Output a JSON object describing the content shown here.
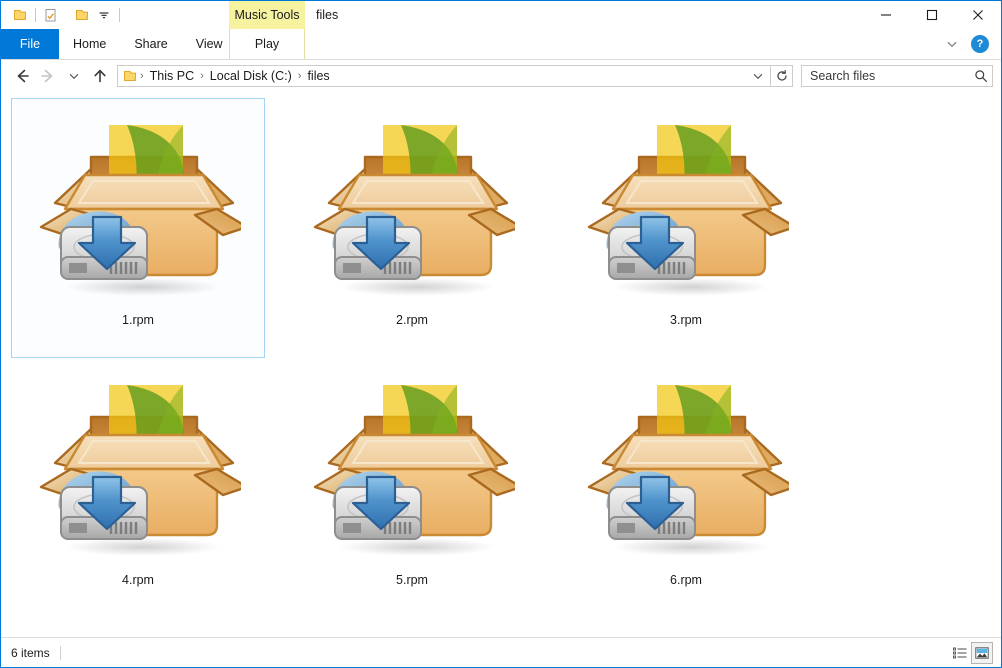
{
  "window": {
    "title": "files",
    "accent_color": "#0078d7",
    "contextual_tab_group": "Music Tools",
    "contextual_tab_color": "#f6f2a0"
  },
  "quick_access": {
    "items": [
      {
        "name": "folder-icon",
        "label": "Folder"
      },
      {
        "name": "properties-icon",
        "label": "Properties"
      },
      {
        "name": "new-folder-icon",
        "label": "New folder"
      },
      {
        "name": "customize-dropdown-icon",
        "label": "Customize Quick Access Toolbar"
      }
    ]
  },
  "window_controls": {
    "minimize": "Minimize",
    "maximize": "Maximize",
    "close": "Close",
    "ribbon_toggle": "Minimize the Ribbon",
    "help": "?"
  },
  "ribbon": {
    "tabs": [
      {
        "label": "File",
        "active_style": "file"
      },
      {
        "label": "Home",
        "active_style": "normal"
      },
      {
        "label": "Share",
        "active_style": "normal"
      },
      {
        "label": "View",
        "active_style": "normal"
      },
      {
        "label": "Play",
        "active_style": "contextual"
      }
    ]
  },
  "address_bar": {
    "back": "Back",
    "forward": "Forward",
    "recent": "Recent locations",
    "up": "Up",
    "breadcrumbs": [
      {
        "label": "This PC"
      },
      {
        "label": "Local Disk (C:)"
      },
      {
        "label": "files"
      }
    ],
    "separator": "›",
    "dropdown": "Previous locations",
    "refresh": "Refresh"
  },
  "search": {
    "placeholder": "Search files",
    "value": "",
    "icon": "search-icon"
  },
  "files": [
    {
      "name": "1.rpm",
      "type": "rpm-package",
      "selected": true
    },
    {
      "name": "2.rpm",
      "type": "rpm-package",
      "selected": false
    },
    {
      "name": "3.rpm",
      "type": "rpm-package",
      "selected": false
    },
    {
      "name": "4.rpm",
      "type": "rpm-package",
      "selected": false
    },
    {
      "name": "5.rpm",
      "type": "rpm-package",
      "selected": false
    },
    {
      "name": "6.rpm",
      "type": "rpm-package",
      "selected": false
    }
  ],
  "status_bar": {
    "item_count": "6 items",
    "view_details": "Details view",
    "view_large_icons": "Large icons view"
  }
}
